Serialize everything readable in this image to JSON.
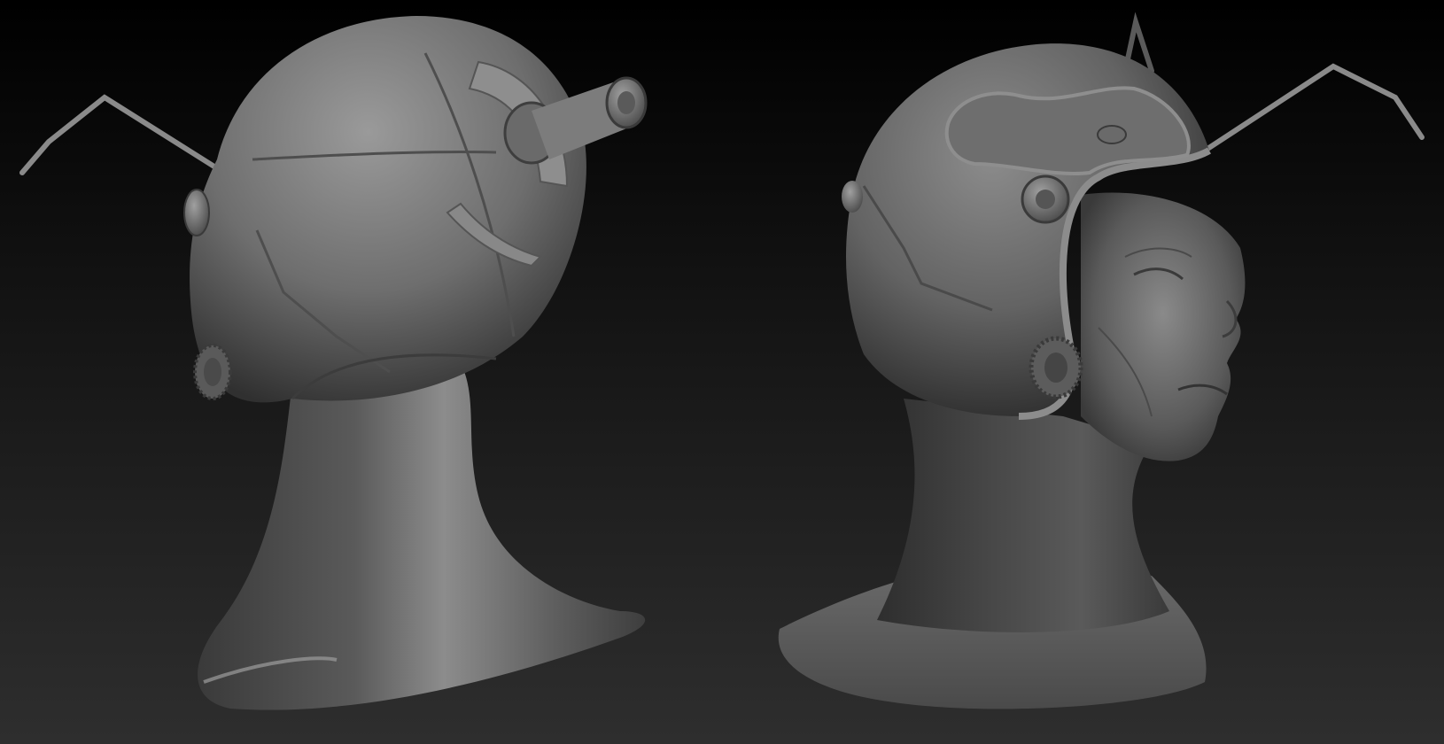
{
  "scene": {
    "description_free": true,
    "background": {
      "top": "#000000",
      "bottom": "#2e2e2e"
    },
    "sculpt_material": {
      "base": "#7a7a7a",
      "highlight": "#b4b4b4",
      "shadow": "#2a2a2a"
    },
    "views": [
      {
        "id": "back-three-quarter",
        "icon": "alien-head-back-view"
      },
      {
        "id": "front-three-quarter",
        "icon": "alien-head-front-view"
      }
    ]
  }
}
